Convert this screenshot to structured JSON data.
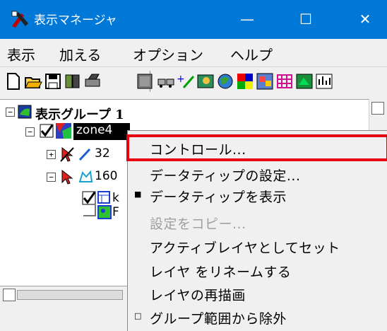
{
  "window": {
    "title": "表示マネージャ",
    "minimize": "—",
    "maximize": "☐",
    "close": "✕",
    "accent": "#0078d7"
  },
  "menu": {
    "items": [
      "表示",
      "加える",
      "オプション",
      "ヘルプ"
    ]
  },
  "toolbar": {
    "icons": [
      "new-file-icon",
      "open-file-icon",
      "save-icon",
      "layer-icon",
      "print-icon",
      "database-icon",
      "vehicles-icon",
      "add-layer-icon",
      "map-icon",
      "globe-icon",
      "color-grid-icon",
      "mosaic-icon",
      "grid-icon",
      "tree-icon",
      "chart-icon"
    ]
  },
  "tree": {
    "group_label": "表示グループ 1",
    "zone_label": "zone4",
    "item1_label": "32",
    "item2_label": "160",
    "sub1_label": "k",
    "sub2_label": "F"
  },
  "context_menu": {
    "items": [
      {
        "label": "コントロール...",
        "enabled": true
      },
      {
        "label": "データティップの設定...",
        "enabled": true
      },
      {
        "label": "データティップを表示",
        "enabled": true,
        "marker": "■"
      },
      {
        "label": "設定をコピー...",
        "enabled": false
      },
      {
        "label": "アクティブレイヤとしてセット",
        "enabled": true
      },
      {
        "label": "レイヤ をリネームする",
        "enabled": true
      },
      {
        "label": "レイヤの再描画",
        "enabled": true
      },
      {
        "label": "グループ範囲から除外",
        "enabled": true,
        "marker": "□"
      }
    ],
    "highlight_color": "#e60012"
  }
}
